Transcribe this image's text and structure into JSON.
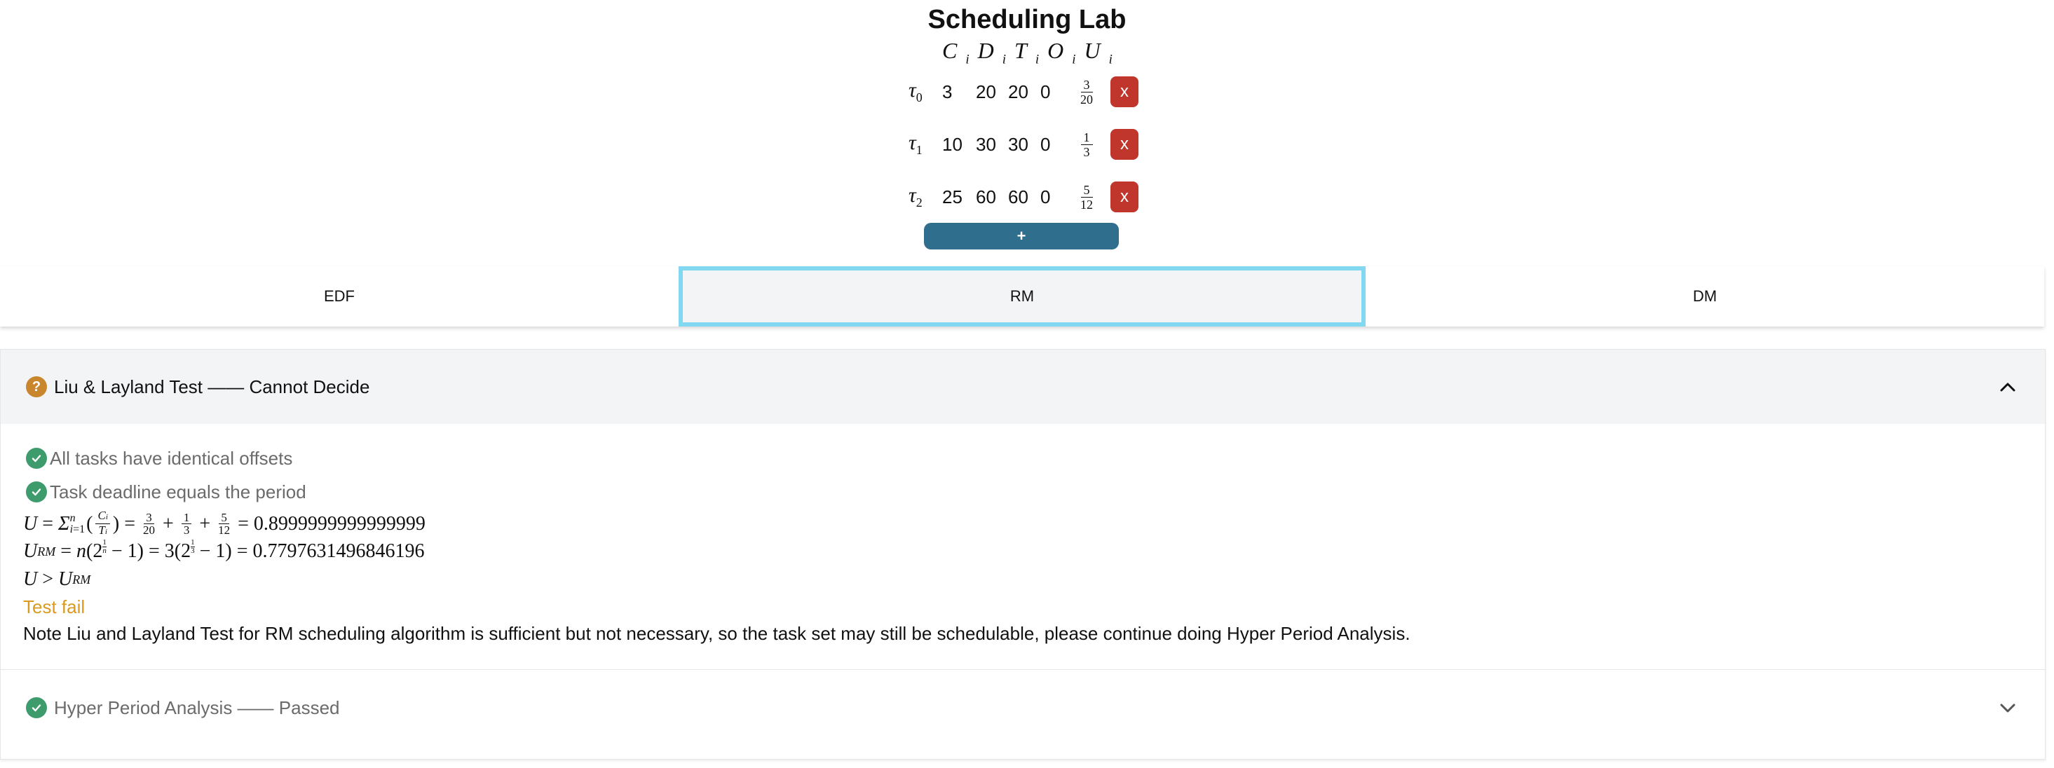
{
  "app": {
    "title": "Scheduling Lab"
  },
  "table": {
    "headers": [
      "C",
      "D",
      "T",
      "O",
      "U"
    ],
    "header_sub": "i",
    "tasks": [
      {
        "name": "τ",
        "index": "0",
        "C": "3",
        "D": "20",
        "T": "20",
        "O": "0",
        "U_num": "3",
        "U_den": "20",
        "delete_label": "x"
      },
      {
        "name": "τ",
        "index": "1",
        "C": "10",
        "D": "30",
        "T": "30",
        "O": "0",
        "U_num": "1",
        "U_den": "3",
        "delete_label": "x"
      },
      {
        "name": "τ",
        "index": "2",
        "C": "25",
        "D": "60",
        "T": "60",
        "O": "0",
        "U_num": "5",
        "U_den": "12",
        "delete_label": "x"
      }
    ],
    "add_label": "+"
  },
  "tabs": [
    {
      "label": "EDF",
      "active": false
    },
    {
      "label": "RM",
      "active": true
    },
    {
      "label": "DM",
      "active": false
    }
  ],
  "liu_layland": {
    "title": "Liu & Layland Test —— Cannot Decide",
    "status_icon": "question-icon",
    "expanded": true,
    "checks": [
      {
        "icon": "check-circle-icon",
        "text": "All tasks have identical offsets"
      },
      {
        "icon": "check-circle-icon",
        "text": "Task deadline equals the period"
      }
    ],
    "u_result": "0.8999999999999999",
    "urm_result": "0.7797631496846196",
    "n": "3",
    "result": "Test fail",
    "note": "Note Liu and Layland Test for RM scheduling algorithm is sufficient but not necessary, so the task set may still be schedulable, please continue doing Hyper Period Analysis."
  },
  "hyper_period": {
    "title": "Hyper Period Analysis —— Passed",
    "status_icon": "check-circle-icon",
    "expanded": false
  },
  "colors": {
    "accent": "#2f6e8c",
    "delete": "#c0362c",
    "active_tab_border": "#81d8f0",
    "warning": "#c9862c",
    "success": "#3e9c6c",
    "fail_text": "#d99a1f"
  }
}
